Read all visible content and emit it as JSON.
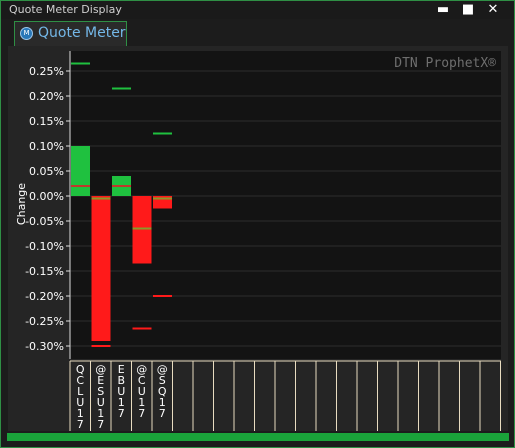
{
  "window": {
    "title": "Quote Meter Display"
  },
  "controls": {
    "minimize": "▬",
    "maximize": "■",
    "close": "✕"
  },
  "tab": {
    "label": "Quote Meter",
    "icon": "quote-meter-icon"
  },
  "watermark": "DTN ProphetX®",
  "colors": {
    "up": "#1fc13f",
    "down": "#ff1a1a",
    "accent": "#2f8f45"
  },
  "chart_data": {
    "type": "bar",
    "ylabel": "Change",
    "ylim": [
      -0.31,
      0.27
    ],
    "yticks": [
      "0.25%",
      "0.20%",
      "0.15%",
      "0.10%",
      "0.05%",
      "0.00%",
      "-0.05%",
      "-0.10%",
      "-0.15%",
      "-0.20%",
      "-0.25%",
      "-0.30%"
    ],
    "ytick_values": [
      0.25,
      0.2,
      0.15,
      0.1,
      0.05,
      0.0,
      -0.05,
      -0.1,
      -0.15,
      -0.2,
      -0.25,
      -0.3
    ],
    "categories": [
      "QCLU17",
      "@ESU17",
      "EBU17",
      "@CU17",
      "@SQ17"
    ],
    "values": [
      0.1,
      -0.29,
      0.04,
      -0.135,
      -0.025
    ],
    "previous": [
      0.02,
      -0.005,
      0.02,
      -0.065,
      -0.005
    ],
    "high": [
      0.265,
      -0.3,
      0.215,
      -0.265,
      0.125
    ],
    "low": [
      0.265,
      -0.3,
      0.215,
      -0.265,
      -0.2
    ],
    "high_marker": [
      0.265,
      null,
      0.215,
      null,
      0.125
    ],
    "low_marker": [
      null,
      -0.3,
      null,
      -0.265,
      -0.2
    ],
    "empty_slots": 17
  }
}
